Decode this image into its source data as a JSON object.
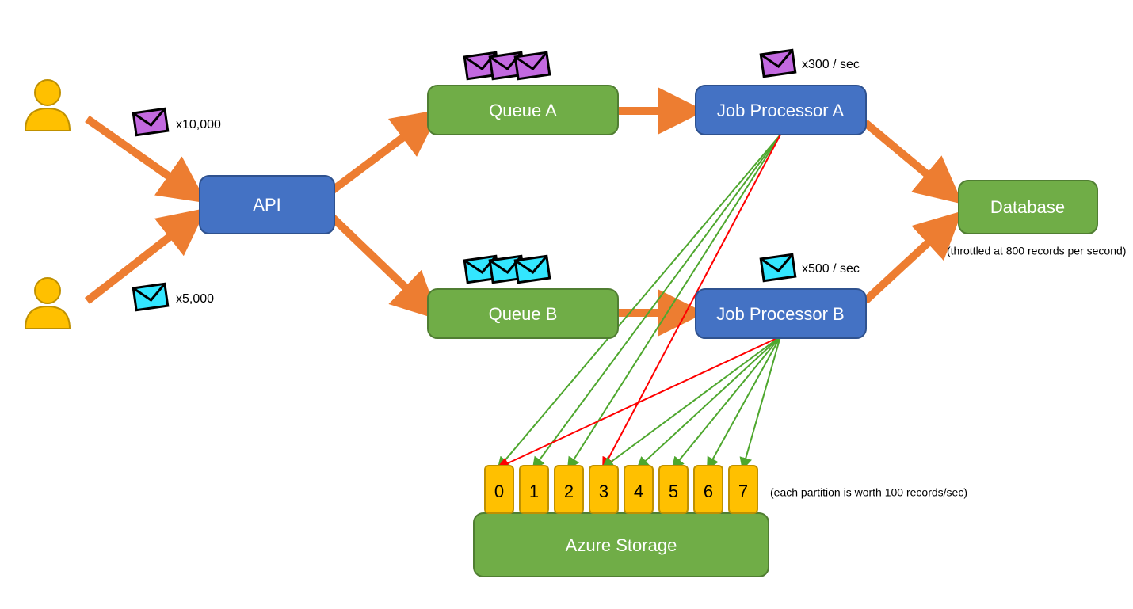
{
  "colors": {
    "orange": "#FFA126",
    "darkOrange": "#ED7D31",
    "blue": "#4472C4",
    "blueStroke": "#2F528F",
    "green": "#70AD47",
    "greenStroke": "#507E32",
    "yellow": "#FFC000",
    "yellowStroke": "#BF9000",
    "purple": "#C369E0",
    "cyan": "#33E6FF",
    "red": "#FF0000",
    "greenLine": "#4EA72E"
  },
  "users": {
    "user1_label": "x10,000",
    "user2_label": "x5,000"
  },
  "api": {
    "label": "API"
  },
  "queues": {
    "a": {
      "label": "Queue A"
    },
    "b": {
      "label": "Queue B"
    }
  },
  "processors": {
    "a": {
      "label": "Job Processor A",
      "rate": "x300 / sec"
    },
    "b": {
      "label": "Job Processor B",
      "rate": "x500 / sec"
    }
  },
  "database": {
    "label": "Database",
    "note": "(throttled at 800 records per second)"
  },
  "storage": {
    "label": "Azure Storage",
    "partitions": [
      "0",
      "1",
      "2",
      "3",
      "4",
      "5",
      "6",
      "7"
    ],
    "note": "(each partition is worth 100 records/sec)"
  }
}
